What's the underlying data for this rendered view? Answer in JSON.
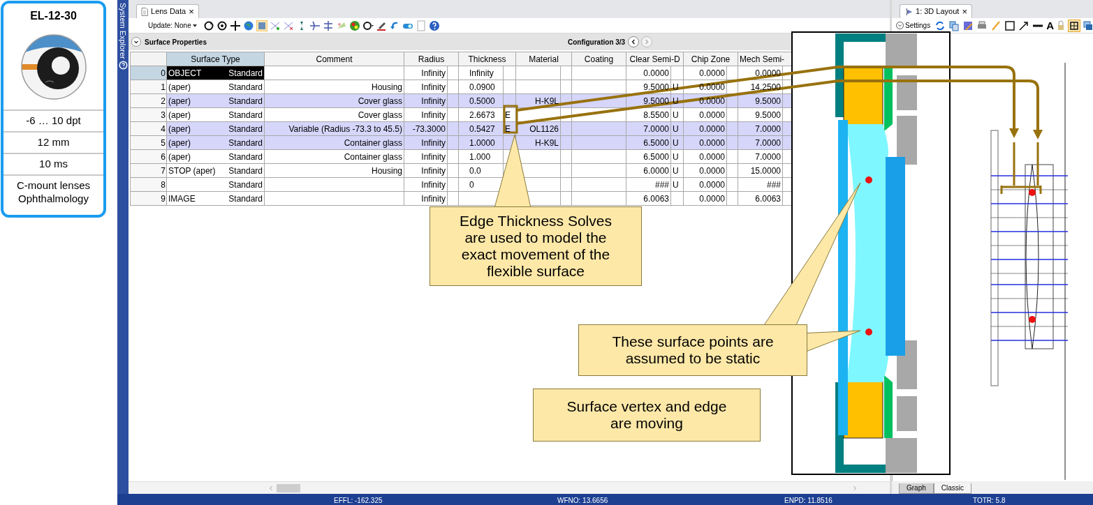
{
  "product_card": {
    "title": "EL-12-30",
    "photo": {
      "kind": "picture"
    },
    "specs": [
      "-6 … 10 dpt",
      "12 mm",
      "10 ms"
    ],
    "applications": [
      "C-mount lenses",
      "Ophthalmology"
    ]
  },
  "side_tab": {
    "label": "System Explorer"
  },
  "lens_data": {
    "tab": {
      "title": "Lens Data",
      "close": "×"
    },
    "update": "Update: None",
    "section": "Surface Properties",
    "configuration": "Configuration 3/3",
    "columns": [
      "Surface Type",
      "Comment",
      "Radius",
      "Thickness",
      "Material",
      "Coating",
      "Clear Semi-D",
      "Chip Zone",
      "Mech Semi-"
    ],
    "rows": [
      {
        "number": "0",
        "name": "OBJECT",
        "type": "Standard",
        "radius": "Infinity",
        "thickness": "Infinity",
        "clear": "0.0000",
        "chip": "0.0000",
        "mech": "0.0000",
        "selected": true,
        "shaded": false
      },
      {
        "number": "1",
        "name": "(aper)",
        "type": "Standard",
        "comment": "Housing",
        "radius": "Infinity",
        "thickness": "0.0900",
        "clear": "9.5000",
        "clear_solve": "U",
        "chip": "0.0000",
        "mech": "14.2500",
        "selected": false,
        "shaded": false
      },
      {
        "number": "2",
        "name": "(aper)",
        "type": "Standard",
        "comment": "Cover glass",
        "radius": "Infinity",
        "thickness": "0.5000",
        "material": "H-K9L",
        "clear": "9.5000",
        "clear_solve": "U",
        "chip": "0.0000",
        "mech": "9.5000",
        "selected": false,
        "shaded": true
      },
      {
        "number": "3",
        "name": "(aper)",
        "type": "Standard",
        "comment": "Cover glass",
        "radius": "Infinity",
        "thickness": "2.6673",
        "thickness_solve": "E",
        "clear": "8.5500",
        "clear_solve": "U",
        "chip": "0.0000",
        "mech": "9.5000",
        "selected": false,
        "shaded": false
      },
      {
        "number": "4",
        "name": "(aper)",
        "type": "Standard",
        "comment": "Variable (Radius -73.3 to 45.5)",
        "radius": "-73.3000",
        "thickness": "0.5427",
        "thickness_solve": "E",
        "material": "OL1126",
        "clear": "7.0000",
        "clear_solve": "U",
        "chip": "0.0000",
        "mech": "7.0000",
        "selected": false,
        "shaded": true
      },
      {
        "number": "5",
        "name": "(aper)",
        "type": "Standard",
        "comment": "Container glass",
        "radius": "Infinity",
        "thickness": "1.0000",
        "material": "H-K9L",
        "clear": "6.5000",
        "clear_solve": "U",
        "chip": "0.0000",
        "mech": "7.0000",
        "selected": false,
        "shaded": true
      },
      {
        "number": "6",
        "name": "(aper)",
        "type": "Standard",
        "comment": "Container glass",
        "radius": "Infinity",
        "thickness": "1.000",
        "clear": "6.5000",
        "clear_solve": "U",
        "chip": "0.0000",
        "mech": "7.0000",
        "selected": false,
        "shaded": false
      },
      {
        "number": "7",
        "name": "STOP (aper)",
        "type": "Standard",
        "comment": "Housing",
        "radius": "Infinity",
        "thickness": "0.0",
        "clear": "6.0000",
        "clear_solve": "U",
        "chip": "0.0000",
        "mech": "15.0000",
        "selected": false,
        "shaded": false
      },
      {
        "number": "8",
        "type": "Standard",
        "radius": "Infinity",
        "thickness": "0",
        "clear": "###",
        "clear_solve": "U",
        "chip": "0.0000",
        "mech": "###",
        "selected": false,
        "shaded": false
      },
      {
        "number": "9",
        "name": "IMAGE",
        "type": "Standard",
        "radius": "Infinity",
        "clear": "6.0063",
        "chip": "0.0000",
        "mech": "6.0063",
        "selected": false,
        "shaded": false
      }
    ]
  },
  "layout_panel": {
    "tab": {
      "title": "1: 3D Layout",
      "close": "×"
    },
    "settings": "Settings",
    "text_tool": "A",
    "bottom_tabs": [
      {
        "label": "Graph",
        "selected": true
      },
      {
        "label": "Classic",
        "selected": false
      }
    ]
  },
  "callouts": [
    {
      "text": "Edge Thickness Solves are used to model the exact movement of the flexible surface"
    },
    {
      "text": "These surface points are assumed to be static"
    },
    {
      "text": "Surface vertex and edge are moving"
    }
  ],
  "status_bar": [
    "EFFL: -162.325",
    "WFNO: 13.6656",
    "ENPD: 11.8516",
    "TOTR: 5.8"
  ]
}
